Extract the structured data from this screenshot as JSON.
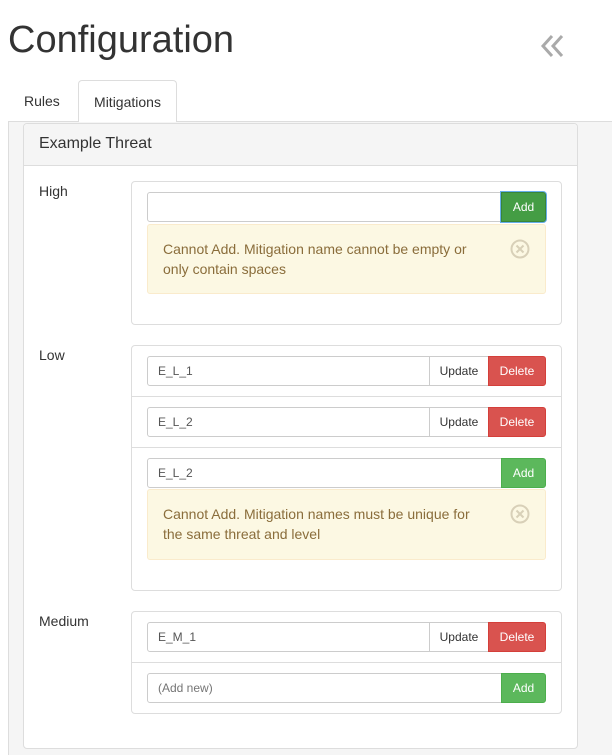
{
  "header": {
    "title": "Configuration",
    "collapse_icon": "double-chevron-left-icon"
  },
  "tabs": [
    {
      "label": "Rules",
      "active": false
    },
    {
      "label": "Mitigations",
      "active": true
    }
  ],
  "panel": {
    "title": "Example Threat"
  },
  "levels": {
    "high": {
      "label": "High",
      "new_input": {
        "value": "",
        "placeholder": ""
      },
      "add_label": "Add",
      "alert": "Cannot Add. Mitigation name cannot be empty or only contain spaces"
    },
    "low": {
      "label": "Low",
      "items": [
        {
          "value": "E_L_1",
          "update_label": "Update",
          "delete_label": "Delete"
        },
        {
          "value": "E_L_2",
          "update_label": "Update",
          "delete_label": "Delete"
        }
      ],
      "new_input": {
        "value": "E_L_2"
      },
      "add_label": "Add",
      "alert": "Cannot Add. Mitigation names must be unique for the same threat and level"
    },
    "medium": {
      "label": "Medium",
      "items": [
        {
          "value": "E_M_1",
          "update_label": "Update",
          "delete_label": "Delete"
        }
      ],
      "new_input": {
        "value": "",
        "placeholder": "(Add new)"
      },
      "add_label": "Add"
    }
  },
  "colors": {
    "add": "#5cb85c",
    "delete": "#d9534f",
    "alert_bg": "#fcf8e3",
    "alert_text": "#8a6d3b"
  }
}
